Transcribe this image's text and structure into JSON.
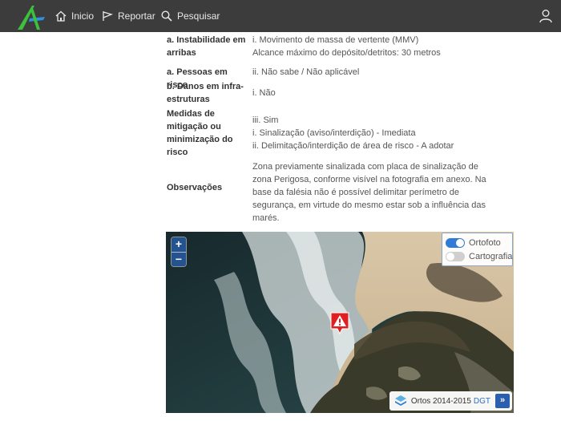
{
  "nav": {
    "home_label": "Inicio",
    "report_label": "Reportar",
    "search_label": "Pesquisar"
  },
  "details": {
    "instability": {
      "label": "a. Instabilidade em arribas",
      "line1": "i. Movimento de massa de vertente (MMV)",
      "line2": "Alcance máximo do depósito/detritos: 30 metros"
    },
    "people_risk": {
      "label": "a. Pessoas em risco",
      "value": "ii. Não sabe / Não aplicável"
    },
    "infrastructure": {
      "label": "b. Danos em infra-estruturas",
      "value": "i. Não"
    },
    "mitigation": {
      "label": "Medidas de mitigação ou minimização do risco",
      "line1": "iii. Sim",
      "line2": "i. Sinalização (aviso/interdição) - Imediata",
      "line3": "ii. Delimitação/interdição de área de risco - A adotar"
    },
    "observations": {
      "label": "Observações",
      "value": "Zona previamente sinalizada com placa de sinalização de zona Perigosa, conforme visível na fotografia em anexo. Na base da falésia não é possível delimitar perímetro de segurança, em virtude do mesmo estar sob a influência das marés."
    }
  },
  "map": {
    "zoom_in": "+",
    "zoom_out": "−",
    "layers": [
      {
        "label": "Ortofoto",
        "on": true
      },
      {
        "label": "Cartografia",
        "on": false
      }
    ],
    "attribution_text": "Ortos 2014-2015",
    "attribution_link": "DGT",
    "expand_label": "»"
  },
  "colors": {
    "navbar": "#3c3c3c",
    "logo_green": "#3cc13a",
    "logo_blue": "#2f8fe0",
    "toggle_on": "#2f7bd6",
    "marker_red": "#e02020"
  }
}
